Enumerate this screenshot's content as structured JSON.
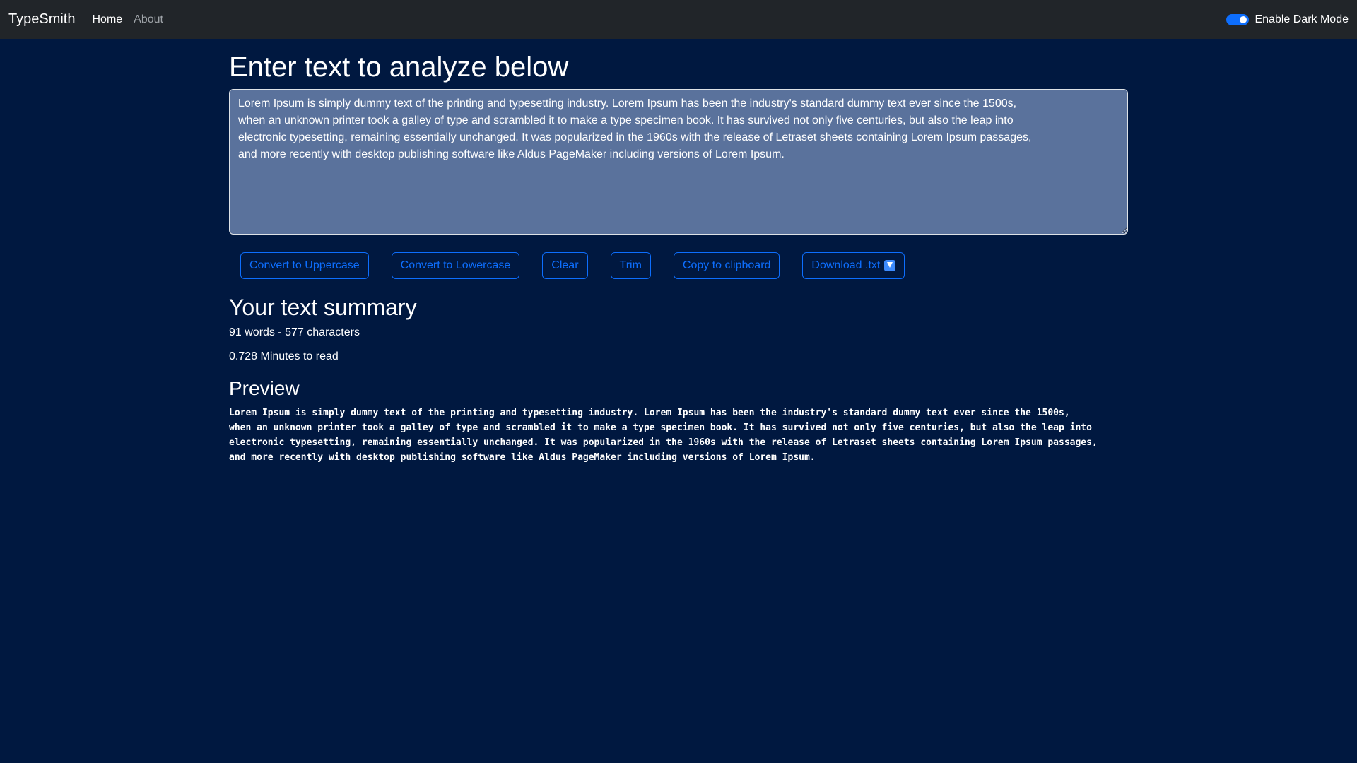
{
  "navbar": {
    "brand": "TypeSmith",
    "links": [
      "Home",
      "About"
    ],
    "dark_mode_label": "Enable Dark Mode",
    "dark_mode_enabled": true
  },
  "main": {
    "title": "Enter text to analyze below",
    "textarea_value": "Lorem Ipsum is simply dummy text of the printing and typesetting industry. Lorem Ipsum has been the industry's standard dummy text ever since the 1500s,\nwhen an unknown printer took a galley of type and scrambled it to make a type specimen book. It has survived not only five centuries, but also the leap into\nelectronic typesetting, remaining essentially unchanged. It was popularized in the 1960s with the release of Letraset sheets containing Lorem Ipsum passages,\nand more recently with desktop publishing software like Aldus PageMaker including versions of Lorem Ipsum.",
    "buttons": {
      "uppercase": "Convert to Uppercase",
      "lowercase": "Convert to Lowercase",
      "clear": "Clear",
      "trim": "Trim",
      "copy": "Copy to clipboard",
      "download": "Download .txt"
    },
    "download_icon": "download-arrow-icon"
  },
  "summary": {
    "title": "Your text summary",
    "counts": "91 words - 577 characters",
    "read_time": "0.728 Minutes to read"
  },
  "preview": {
    "title": "Preview",
    "text": "Lorem Ipsum is simply dummy text of the printing and typesetting industry. Lorem Ipsum has been the industry's standard dummy text ever since the 1500s,\nwhen an unknown printer took a galley of type and scrambled it to make a type specimen book. It has survived not only five centuries, but also the leap into\nelectronic typesetting, remaining essentially unchanged. It was popularized in the 1960s with the release of Letraset sheets containing Lorem Ipsum passages,\nand more recently with desktop publishing software like Aldus PageMaker including versions of Lorem Ipsum."
  },
  "colors": {
    "page_background": "#001840",
    "navbar_background": "#212529",
    "textarea_background": "#5a729c",
    "accent": "#0d6efd"
  }
}
